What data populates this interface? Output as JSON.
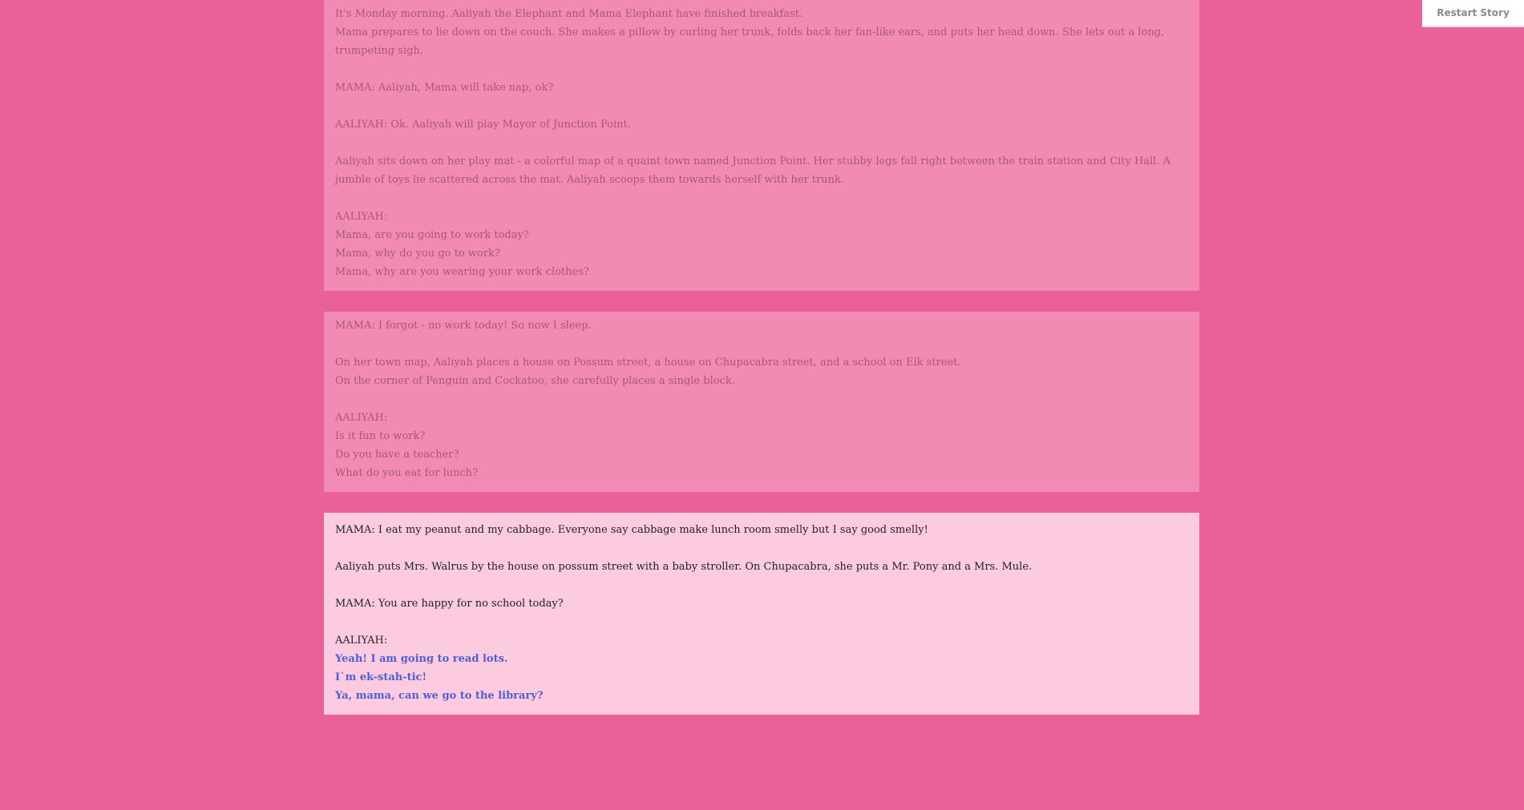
{
  "restart_button": {
    "label": "Restart Story"
  },
  "passages": [
    {
      "state": "past",
      "lines": [
        "It's Monday morning. Aaliyah the Elephant and Mama Elephant have finished breakfast.",
        "Mama prepares to lie down on the couch. She makes a pillow by curling her trunk, folds back her fan-like ears, and puts her head down. She lets out a long, trumpeting sigh.",
        "",
        "MAMA: Aaliyah, Mama will take nap, ok?",
        "",
        "AALIYAH: Ok. Aaliyah will play Mayor of Junction Point.",
        "",
        "Aaliyah sits down on her play mat - a colorful map of a quaint town named Junction Point. Her stubby legs fall right between the train station and City Hall. A jumble of toys lie scattered across the mat. Aaliyah scoops them towards herself with her trunk.",
        "",
        "AALIYAH:",
        "Mama, are you going to work today?",
        "Mama, why do you go to work?",
        "Mama, why are you wearing your work clothes?"
      ]
    },
    {
      "state": "past",
      "lines": [
        "MAMA: I forgot - no work today! So now I sleep.",
        "",
        "On her town map, Aaliyah places a house on Possum street, a house on Chupacabra street, and a school on Elk street.",
        "On the corner of Penguin and Cockatoo, she carefully places a single block.",
        "",
        "AALIYAH:",
        "Is it fun to work?",
        "Do you have a teacher?",
        "What do you eat for lunch?"
      ]
    },
    {
      "state": "current",
      "lines": [
        "MAMA: I eat my peanut and my cabbage. Everyone say cabbage make lunch room smelly but I say good smelly!",
        "",
        "Aaliyah puts Mrs. Walrus by the house on possum street with a baby stroller. On Chupacabra, she puts a Mr. Pony and a Mrs. Mule.",
        "",
        "MAMA: You are happy for no school today?",
        "",
        "AALIYAH:"
      ],
      "choices": [
        "Yeah! I am going to read lots.",
        "I`m ek-stah-tic!",
        "Ya, mama, can we go to the library?"
      ]
    }
  ]
}
